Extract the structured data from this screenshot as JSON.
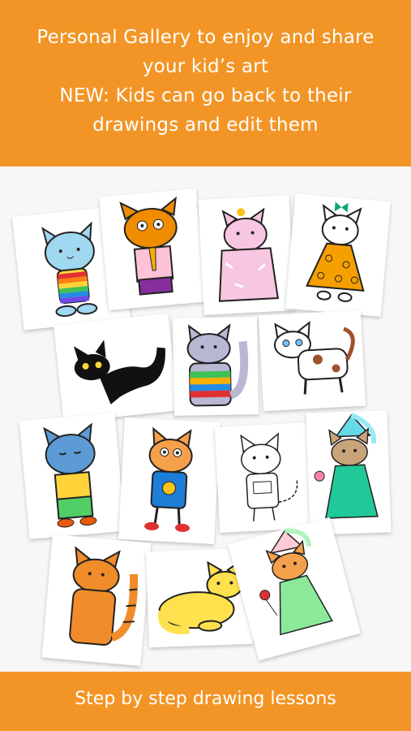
{
  "header": {
    "line1": "Personal Gallery to enjoy and share",
    "line2": "your kid’s art",
    "line3": "NEW: Kids can go back to their",
    "line4": "drawings and edit them"
  },
  "gallery": {
    "drawings": [
      {
        "icon": "rainbow-cat-icon"
      },
      {
        "icon": "tie-dog-icon"
      },
      {
        "icon": "pink-fluffy-cat-icon"
      },
      {
        "icon": "polka-dress-cat-icon"
      },
      {
        "icon": "black-cat-icon"
      },
      {
        "icon": "striped-cat-icon"
      },
      {
        "icon": "spotted-cat-icon"
      },
      {
        "icon": "blue-cat-icon"
      },
      {
        "icon": "smiley-shirt-cat-icon"
      },
      {
        "icon": "outline-cat-icon"
      },
      {
        "icon": "princess-cat-icon"
      },
      {
        "icon": "orange-cat-icon"
      },
      {
        "icon": "sleeping-yellow-cat-icon"
      },
      {
        "icon": "fairy-cat-icon"
      }
    ]
  },
  "footer": {
    "label": "Step by step drawing lessons"
  },
  "colors": {
    "banner": "#f29526",
    "text": "#ffffff",
    "background": "#f7f7f7"
  }
}
